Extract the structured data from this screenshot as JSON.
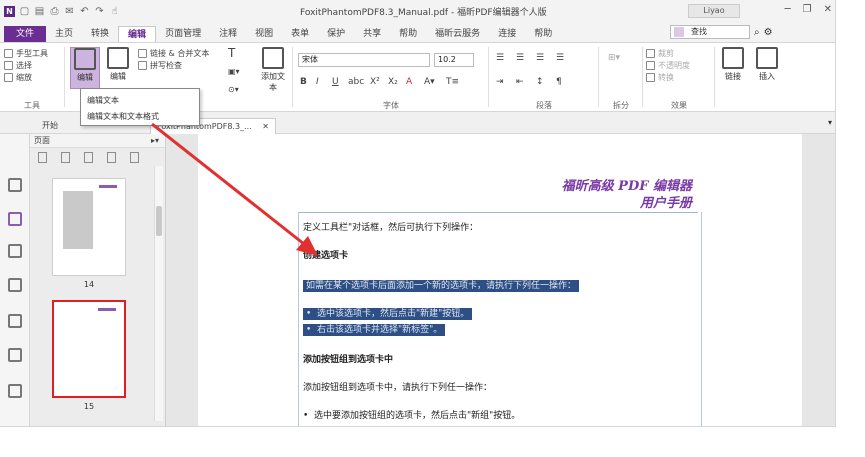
{
  "title_bar": {
    "window_title": "FoxitPhantomPDF8.3_Manual.pdf - 福昕PDF编辑器个人版",
    "user": "Liyao",
    "quick_access_icons": [
      "app-logo-icon",
      "open-icon",
      "save-icon",
      "print-icon",
      "email-icon",
      "undo-icon",
      "redo-icon",
      "hand-icon"
    ],
    "window_controls": [
      "minimize",
      "restore",
      "close"
    ]
  },
  "menu": {
    "tabs": [
      "文件",
      "主页",
      "转换",
      "编辑",
      "页面管理",
      "注释",
      "视图",
      "表单",
      "保护",
      "共享",
      "帮助",
      "福昕云服务",
      "连接",
      "帮助"
    ],
    "active_index": 3,
    "search_value": "查找"
  },
  "ribbon": {
    "tools_group": {
      "items": [
        "手型工具",
        "选择",
        "缩放"
      ],
      "label": "工具"
    },
    "edit_text_label": "编辑",
    "edit_object_label": "编辑",
    "link_merge_label": "链接 & 合并文本",
    "spellcheck_label": "拼写检查",
    "add_text_label": "添加文本",
    "font_name": "宋体",
    "font_size": "10.2",
    "font_group_label": "字体",
    "paragraph_group_label": "段落",
    "split_group_label": "拆分",
    "effects": {
      "items": [
        "裁剪",
        "不透明度",
        "转换"
      ],
      "label": "效果"
    },
    "link_label": "链接",
    "insert_label": "插入"
  },
  "tooltip": {
    "title": "编辑文本",
    "description": "编辑文本和文本格式"
  },
  "doc_tabs": {
    "start_tab": "开始",
    "active_tab": "FoxitPhantomPDF8.3_..."
  },
  "side_panel": {
    "title": "页面",
    "thumbnails": [
      {
        "page": "14"
      },
      {
        "page": "15"
      }
    ]
  },
  "page": {
    "header": [
      "福昕高级 PDF 编辑器",
      "用户手册"
    ],
    "lines": [
      "定义工具栏\"对话框，然后可执行下列操作：",
      "创建选项卡",
      "如需在某个选项卡后面添加一个新的选项卡，请执行下列任一操作：",
      "选中该选项卡，然后点击\"新建\"按钮。",
      "右击该选项卡并选择\"新标签\"。",
      "添加按钮组到选项卡中",
      "添加按钮组到选项卡中，请执行下列任一操作：",
      "选中要添加按钮组的选项卡，然后点击\"新组\"按钮。"
    ]
  },
  "colors": {
    "accent": "#6a2d91",
    "selection": "#2d4f86",
    "arrow": "#e03030",
    "header_text": "#7a3aa6"
  }
}
